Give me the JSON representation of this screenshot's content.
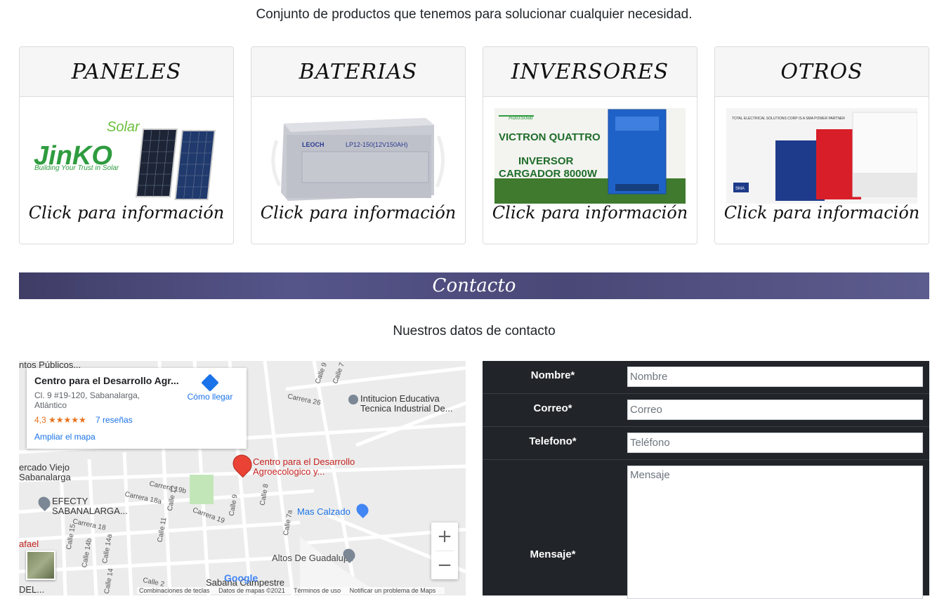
{
  "intro": "Conjunto de productos que tenemos para solucionar cualquier necesidad.",
  "cards": [
    {
      "title": "PANELES",
      "cta": "Click para información",
      "brand": "JinKO",
      "brand_sub": "Solar",
      "tagline": "Building Your Trust in Solar"
    },
    {
      "title": "BATERIAS",
      "cta": "Click para información",
      "label": "LP12-150(12V150AH)",
      "brand": "LEOCH"
    },
    {
      "title": "INVERSORES",
      "cta": "Click para información",
      "brand": "AutoSolar",
      "line1": "VICTRON QUATTRO",
      "line2": "INVERSOR",
      "line3": "CARGADOR 8000W"
    },
    {
      "title": "OTROS",
      "cta": "Click para información",
      "header": "TOTAL ELECTRICAL SOLUTIONS CORP IS A SMA POWER PARTNER",
      "brand": "SMA"
    }
  ],
  "contact": {
    "banner": "Contacto",
    "subtitle": "Nuestros datos de contacto"
  },
  "map": {
    "place_name": "Centro para el Desarrollo Agr...",
    "address": "Cl. 9 #19-120, Sabanalarga, Atlántico",
    "rating": "4,3 ★★★★★",
    "reviews": "7 reseñas",
    "enlarge": "Ampliar el mapa",
    "directions": "Cómo llegar",
    "pin_label": "Centro para el Desarrollo Agroecologico y...",
    "labels": {
      "school": "Intitucion Educativa Tecnica Industrial De...",
      "mas_calzado": "Mas Calzado",
      "altos": "Altos De Guadalupe",
      "efecty": "EFECTY SABANALARGA...",
      "mercado": "ercado Viejo Sabanalarga",
      "publicos": "ntos Públicos...",
      "rafael": "afael",
      "campestre": "Sabana Campestre",
      "del": "DEL..."
    },
    "streets": [
      "Calle 9",
      "Carrera 26",
      "Calle 7",
      "Carrera 19b",
      "Carrera 18a",
      "Calle 12",
      "Carrera 19",
      "Calle 9",
      "Calle 8",
      "Calle 7a",
      "Carrera 18",
      "Calle 11",
      "Calle 14b",
      "Calle 14a",
      "Calle 15",
      "Calle 14",
      "Calle 2"
    ],
    "zoom_in": "+",
    "zoom_out": "−",
    "google": "Google",
    "footer": [
      "Combinaciones de teclas",
      "Datos de mapas ©2021",
      "Términos de uso",
      "Notificar un problema de Maps"
    ]
  },
  "form": {
    "name_label": "Nombre*",
    "name_placeholder": "Nombre",
    "email_label": "Correo*",
    "email_placeholder": "Correo",
    "phone_label": "Telefono*",
    "phone_placeholder": "Teléfono",
    "message_label": "Mensaje*",
    "message_placeholder": "Mensaje"
  }
}
